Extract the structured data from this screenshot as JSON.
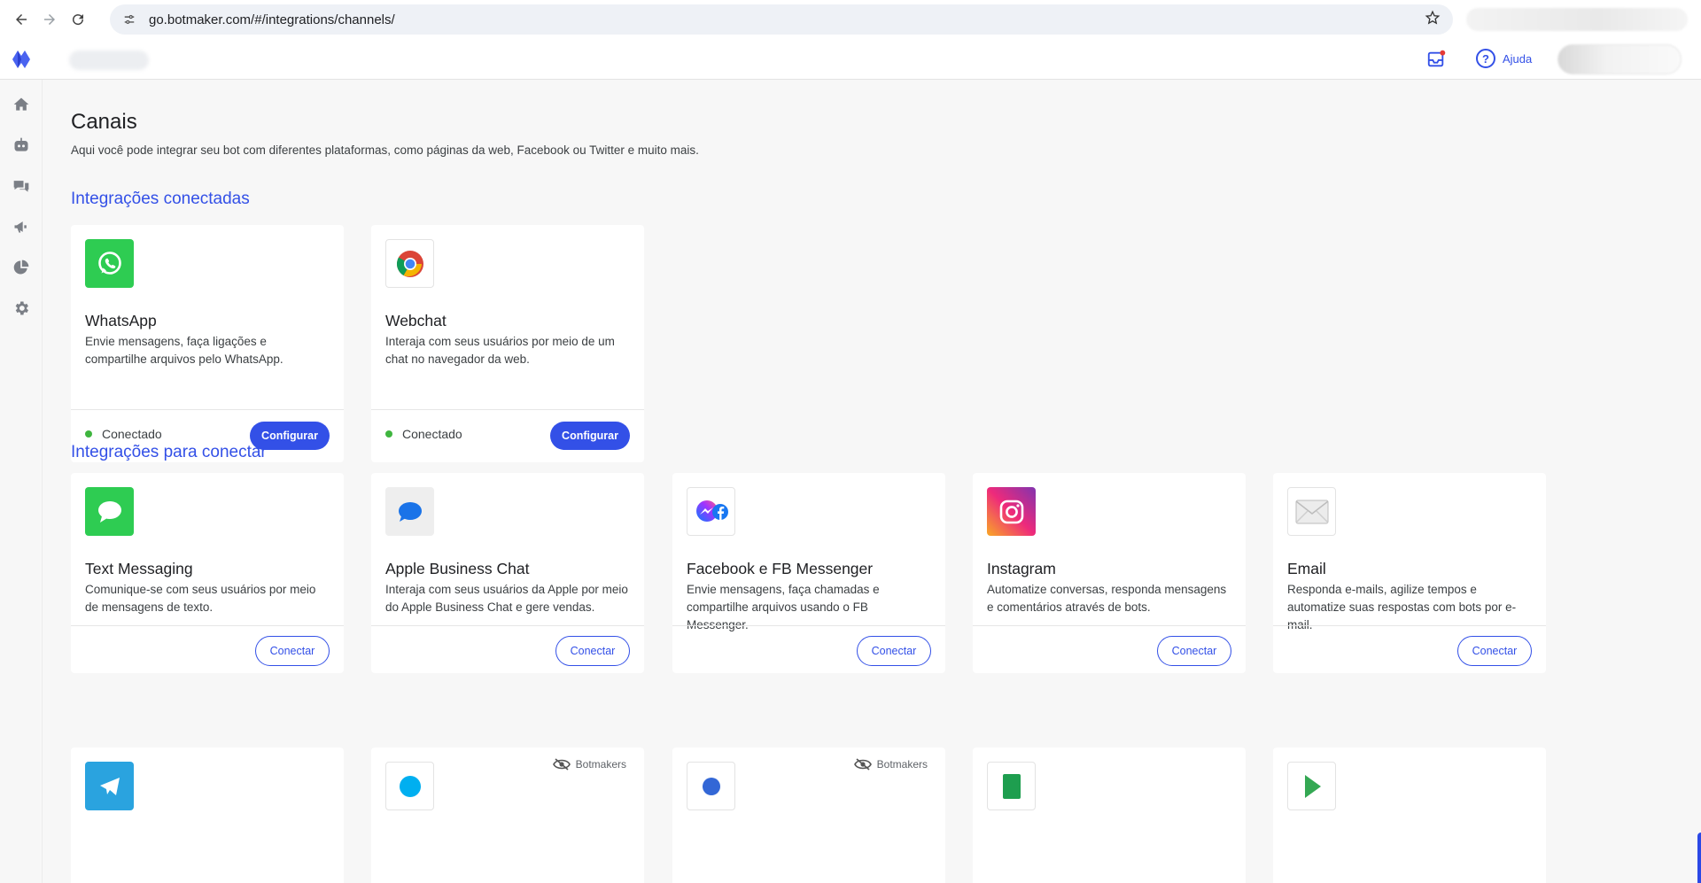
{
  "browser": {
    "url": "go.botmaker.com/#/integrations/channels/",
    "back_icon": "arrow-left",
    "forward_icon": "arrow-right",
    "reload_icon": "reload",
    "star_icon": "star"
  },
  "header": {
    "help_label": "Ajuda",
    "inbox_icon": "inbox",
    "help_icon": "question-circle"
  },
  "sidebar": {
    "items": [
      {
        "name": "home",
        "icon": "home-icon"
      },
      {
        "name": "bots",
        "icon": "robot-icon"
      },
      {
        "name": "chats",
        "icon": "chat-icon"
      },
      {
        "name": "campaigns",
        "icon": "megaphone-icon"
      },
      {
        "name": "reports",
        "icon": "pie-chart-icon"
      },
      {
        "name": "settings",
        "icon": "gear-icon"
      }
    ]
  },
  "page": {
    "title": "Canais",
    "description": "Aqui você pode integrar seu bot com diferentes plataformas, como páginas da web, Facebook ou Twitter e muito mais."
  },
  "connected": {
    "title": "Integrações conectadas",
    "cards": [
      {
        "name": "WhatsApp",
        "desc": "Envie mensagens, faça ligações e compartilhe arquivos pelo WhatsApp.",
        "status": "Conectado",
        "button": "Configurar",
        "icon": "whatsapp-icon"
      },
      {
        "name": "Webchat",
        "desc": "Interaja com seus usuários por meio de um chat no navegador da web.",
        "status": "Conectado",
        "button": "Configurar",
        "icon": "chrome-icon"
      }
    ]
  },
  "to_connect": {
    "title": "Integrações para conectar",
    "cards": [
      {
        "name": "Text Messaging",
        "desc": "Comunique-se com seus usuários por meio de mensagens de texto.",
        "button": "Conectar",
        "icon": "sms-icon"
      },
      {
        "name": "Apple Business Chat",
        "desc": "Interaja com seus usuários da Apple por meio do Apple Business Chat e gere vendas.",
        "button": "Conectar",
        "icon": "apple-chat-icon"
      },
      {
        "name": "Facebook e FB Messenger",
        "desc": "Envie mensagens, faça chamadas e compartilhe arquivos usando o FB Messenger.",
        "button": "Conectar",
        "icon": "messenger-icon"
      },
      {
        "name": "Instagram",
        "desc": "Automatize conversas, responda mensagens e comentários através de bots.",
        "button": "Conectar",
        "icon": "instagram-icon"
      },
      {
        "name": "Email",
        "desc": "Responda e-mails, agilize tempos e automatize suas respostas com bots por e-mail.",
        "button": "Conectar",
        "icon": "mail-icon"
      }
    ],
    "partial_row": [
      {
        "icon": "telegram-icon",
        "tag": ""
      },
      {
        "icon": "skype-icon",
        "tag": "Botmakers"
      },
      {
        "icon": "chat-bubble-icon",
        "tag": "Botmakers"
      },
      {
        "icon": "sheet-icon",
        "tag": ""
      },
      {
        "icon": "play-icon",
        "tag": ""
      }
    ]
  },
  "floating": {
    "icon": "waving-hand-icon"
  }
}
